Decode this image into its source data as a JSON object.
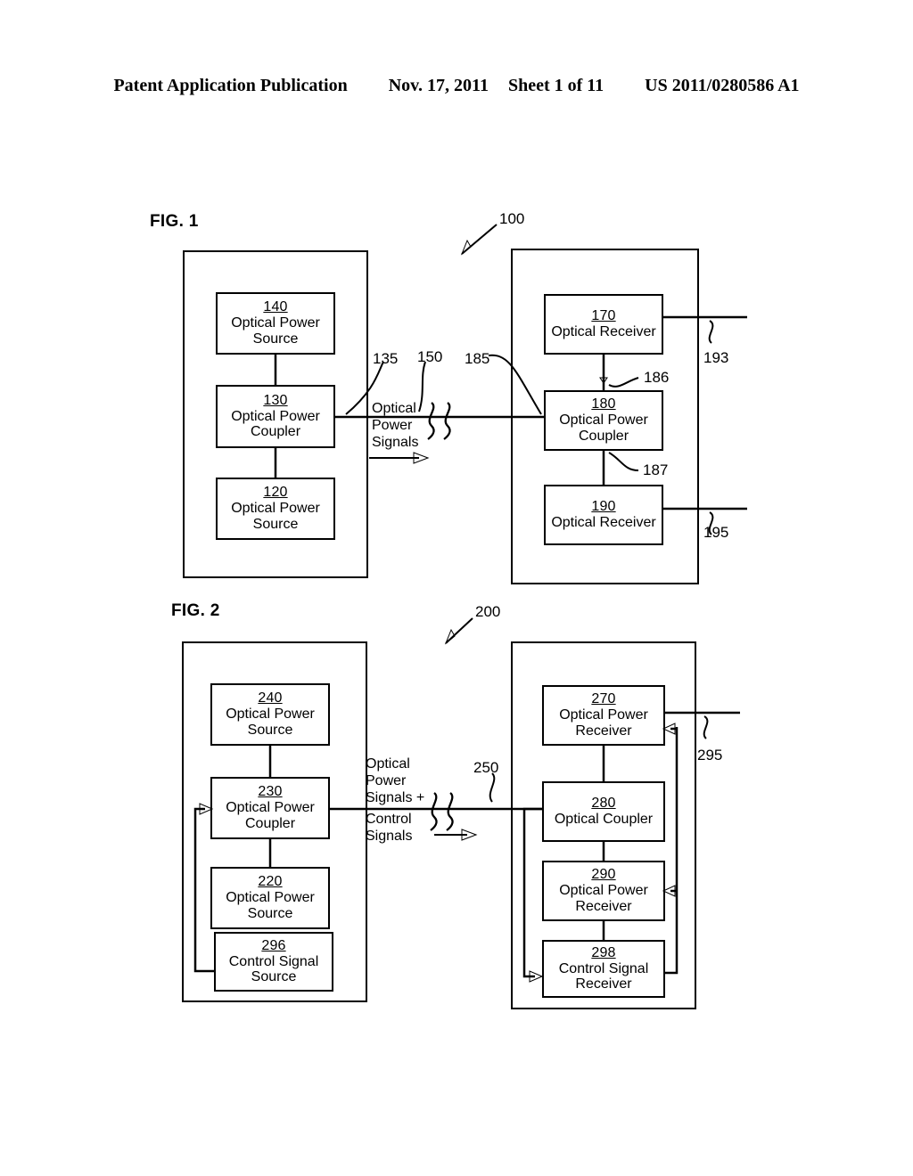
{
  "header": {
    "publication": "Patent Application Publication",
    "date": "Nov. 17, 2011",
    "sheet": "Sheet 1 of 11",
    "doc_number": "US 2011/0280586 A1"
  },
  "figures": [
    {
      "label": "FIG. 1",
      "ref": "100",
      "transmitter": {
        "nodes": [
          {
            "ref": "140",
            "name": "Optical Power\nSource"
          },
          {
            "ref": "130",
            "name": "Optical Power\nCoupler"
          },
          {
            "ref": "120",
            "name": "Optical Power\nSource"
          }
        ]
      },
      "link": {
        "text_top": "Optical\nPower\nSignals",
        "labels": [
          "135",
          "150",
          "185"
        ]
      },
      "receiver": {
        "nodes": [
          {
            "ref": "170",
            "name": "Optical Receiver"
          },
          {
            "ref": "180",
            "name": "Optical Power\nCoupler"
          },
          {
            "ref": "190",
            "name": "Optical Receiver"
          }
        ],
        "internal_labels": [
          "186",
          "187"
        ],
        "output_labels": [
          "193",
          "195"
        ]
      }
    },
    {
      "label": "FIG. 2",
      "ref": "200",
      "transmitter": {
        "nodes": [
          {
            "ref": "240",
            "name": "Optical Power\nSource"
          },
          {
            "ref": "230",
            "name": "Optical Power\nCoupler"
          },
          {
            "ref": "220",
            "name": "Optical Power\nSource"
          },
          {
            "ref": "296",
            "name": "Control Signal\nSource"
          }
        ]
      },
      "link": {
        "text_top": "Optical\nPower\nSignals +",
        "text_bottom": "Control\nSignals",
        "labels": [
          "250"
        ]
      },
      "receiver": {
        "nodes": [
          {
            "ref": "270",
            "name": "Optical Power\nReceiver"
          },
          {
            "ref": "280",
            "name": "Optical Coupler"
          },
          {
            "ref": "290",
            "name": "Optical Power\nReceiver"
          },
          {
            "ref": "298",
            "name": "Control Signal\nReceiver"
          }
        ],
        "output_labels": [
          "295"
        ]
      }
    }
  ],
  "colors": {
    "ink": "#000000",
    "paper": "#ffffff"
  }
}
